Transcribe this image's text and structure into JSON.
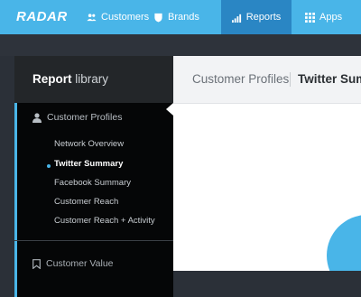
{
  "brand": {
    "logo": "RADAR"
  },
  "nav": [
    {
      "label": "Customers",
      "icon": "users-icon"
    },
    {
      "label": "Brands",
      "icon": "shield-icon"
    },
    {
      "label": "Reports",
      "icon": "bars-icon",
      "active": true
    },
    {
      "label": "Apps",
      "icon": "grid-icon"
    }
  ],
  "sidebar": {
    "title_bold": "Report",
    "title_light": " library",
    "groups": [
      {
        "label": "Customer Profiles",
        "icon": "person-icon",
        "items": [
          {
            "label": "Network Overview"
          },
          {
            "label": "Twitter Summary",
            "selected": true
          },
          {
            "label": "Facebook Summary"
          },
          {
            "label": "Customer Reach"
          },
          {
            "label": "Customer Reach + Activity"
          }
        ]
      },
      {
        "label": "Customer Value",
        "icon": "bookmark-icon"
      }
    ]
  },
  "main": {
    "breadcrumb": [
      "Customer Profiles",
      "Twitter Summary"
    ]
  },
  "colors": {
    "accent": "#49b5e8",
    "nav_active": "#2a86c4",
    "sidebar_active_bg": "#050607"
  }
}
